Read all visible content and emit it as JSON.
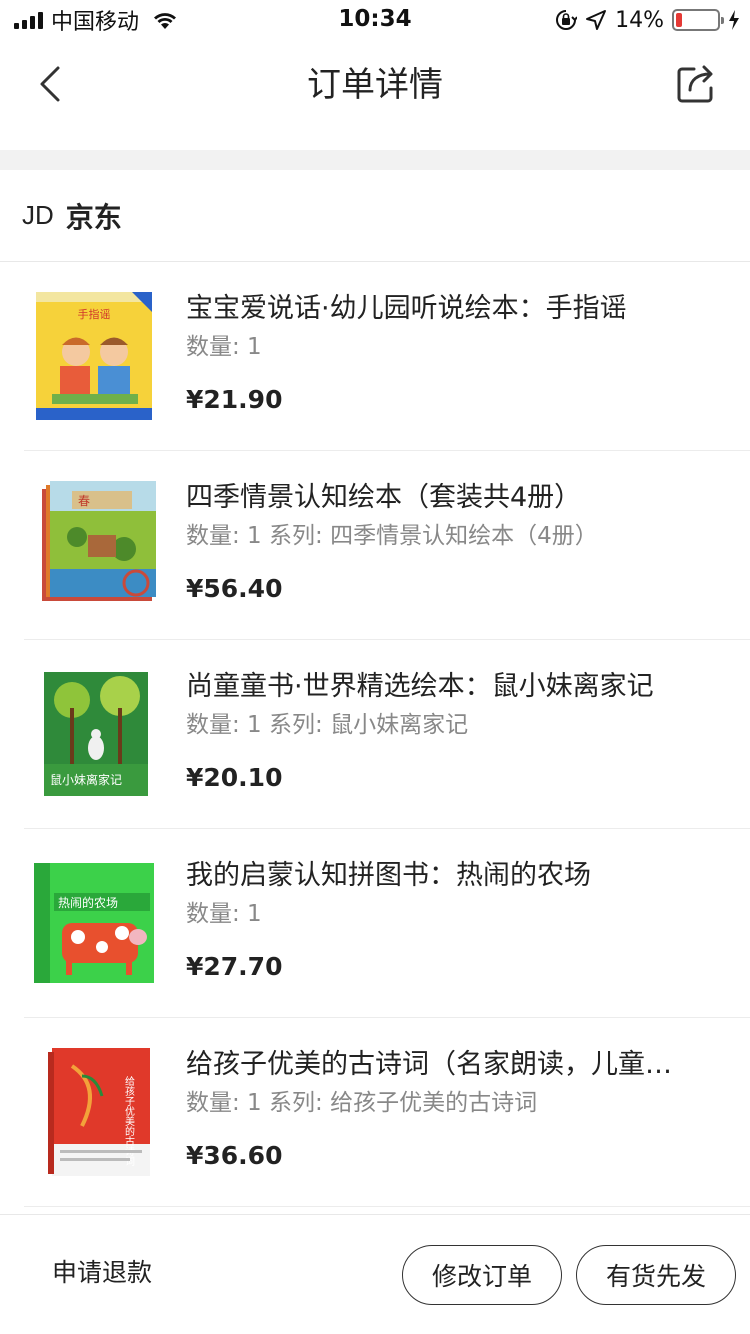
{
  "status_bar": {
    "carrier": "中国移动",
    "time": "10:34",
    "battery_percent": "14%",
    "battery_level": 0.14,
    "icons": [
      "signal-icon",
      "wifi-icon",
      "orientation-lock-icon",
      "location-icon",
      "battery-icon",
      "charging-icon"
    ]
  },
  "nav": {
    "title": "订单详情",
    "back_icon": "chevron-left-icon",
    "share_icon": "share-icon"
  },
  "shop": {
    "logo": "JD",
    "name": "京东"
  },
  "items": [
    {
      "title": "宝宝爱说话·幼儿园听说绘本：手指谣",
      "spec": "数量: 1",
      "price": "¥21.90",
      "cover_text": "手指谣"
    },
    {
      "title": "四季情景认知绘本（套装共4册）",
      "spec": "数量: 1 系列: 四季情景认知绘本（4册）",
      "price": "¥56.40",
      "cover_text": "春"
    },
    {
      "title": "尚童童书·世界精选绘本：鼠小妹离家记",
      "spec": "数量: 1 系列: 鼠小妹离家记",
      "price": "¥20.10",
      "cover_text": "鼠小妹离家记"
    },
    {
      "title": "我的启蒙认知拼图书：热闹的农场",
      "spec": "数量: 1",
      "price": "¥27.70",
      "cover_text": "热闹的农场"
    },
    {
      "title": "给孩子优美的古诗词（名家朗读，儿童…",
      "spec": "数量: 1 系列: 给孩子优美的古诗词",
      "price": "¥36.60",
      "cover_text": "给孩子优美的古诗词"
    }
  ],
  "bottom_bar": {
    "refund_label": "申请退款",
    "modify_label": "修改订单",
    "ship_label": "有货先发"
  }
}
